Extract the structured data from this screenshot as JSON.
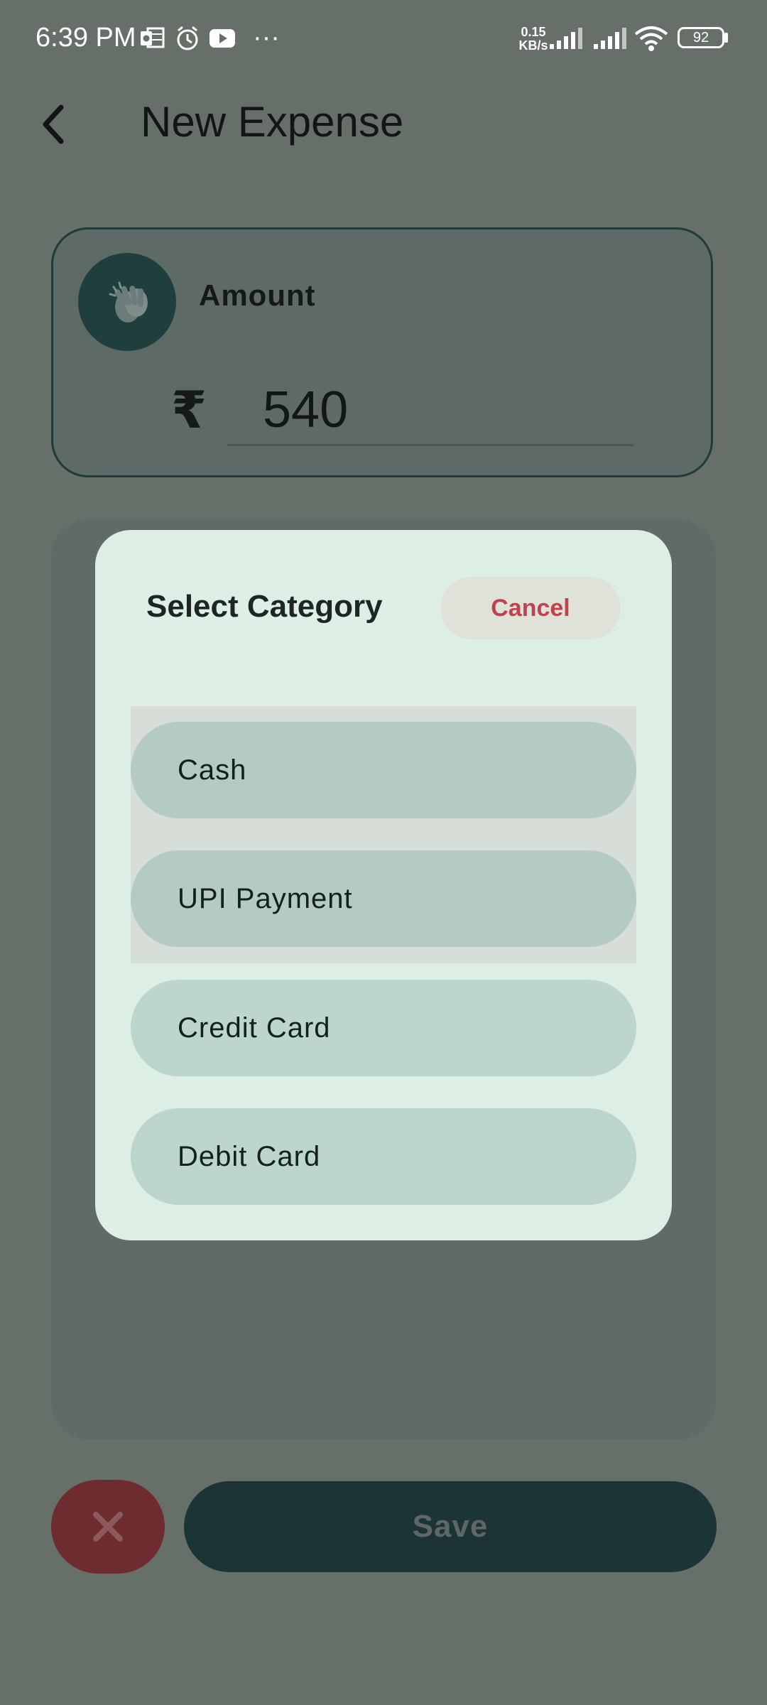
{
  "status_bar": {
    "time": "6:39 PM",
    "net_speed_value": "0.15",
    "net_speed_unit": "KB/s",
    "battery": "92",
    "more": "···",
    "icons": [
      "outlook-icon",
      "alarm-icon",
      "youtube-icon",
      "signal-icon",
      "signal-icon",
      "wifi-icon",
      "battery-icon"
    ]
  },
  "header": {
    "title": "New Expense",
    "back_icon": "chevron-left-icon"
  },
  "amount_card": {
    "label": "Amount",
    "icon": "clapping-hands-icon",
    "currency_symbol": "₹",
    "amount_value": "540"
  },
  "dialog": {
    "title": "Select Category",
    "cancel_label": "Cancel",
    "options": [
      {
        "label": "Cash"
      },
      {
        "label": "UPI Payment"
      },
      {
        "label": "Credit Card"
      },
      {
        "label": "Debit Card"
      }
    ]
  },
  "actions": {
    "discard_icon": "close-icon",
    "save_label": "Save"
  },
  "colors": {
    "accent_dark": "#1b3436",
    "danger": "#c0424d",
    "dialog_bg": "#ddeee4",
    "option_bg": "#bcd6cc"
  }
}
